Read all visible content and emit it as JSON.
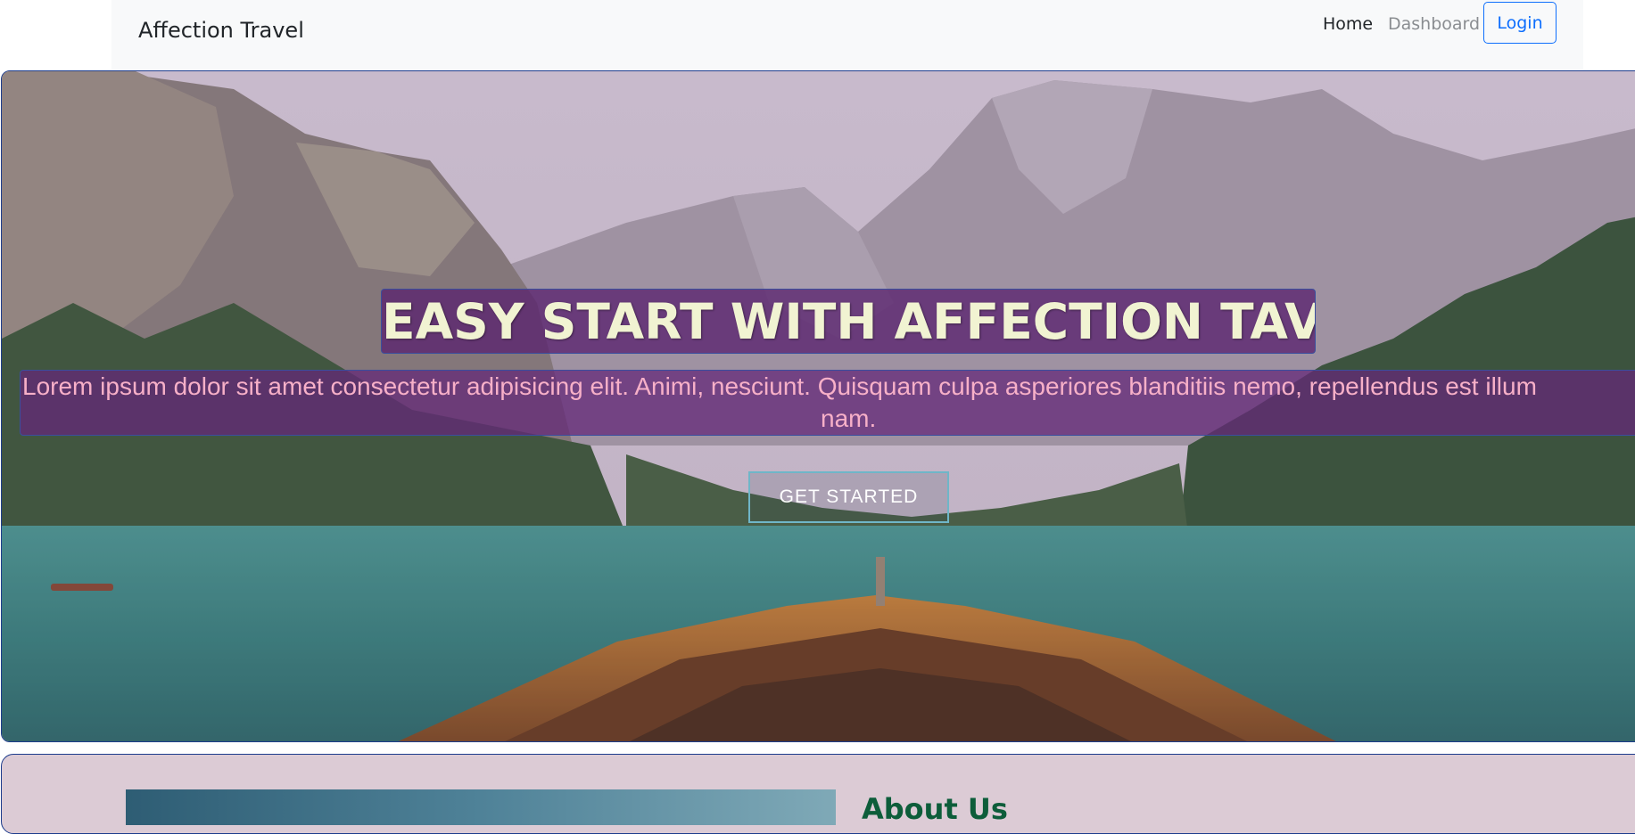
{
  "navbar": {
    "brand": "Affection Travel",
    "links": [
      {
        "label": "Home"
      },
      {
        "label": "Dashboard"
      }
    ],
    "login_label": "Login"
  },
  "hero": {
    "title": "EASY START WITH AFFECTION TAVEL",
    "subtitle_line1": "Lorem ipsum dolor sit amet consectetur adipisicing elit. Animi, nesciunt. Quisquam culpa asperiores blanditiis nemo, repellendus est illum",
    "subtitle_line2": "nam.",
    "cta_label": "GET STARTED"
  },
  "about": {
    "title": "About Us"
  },
  "colors": {
    "brand_primary": "#0d6efd",
    "title_band": "#5a236e",
    "title_text": "#f1f3d2",
    "subtitle_text": "#f7b0c8",
    "about_title": "#0d5d3a"
  }
}
